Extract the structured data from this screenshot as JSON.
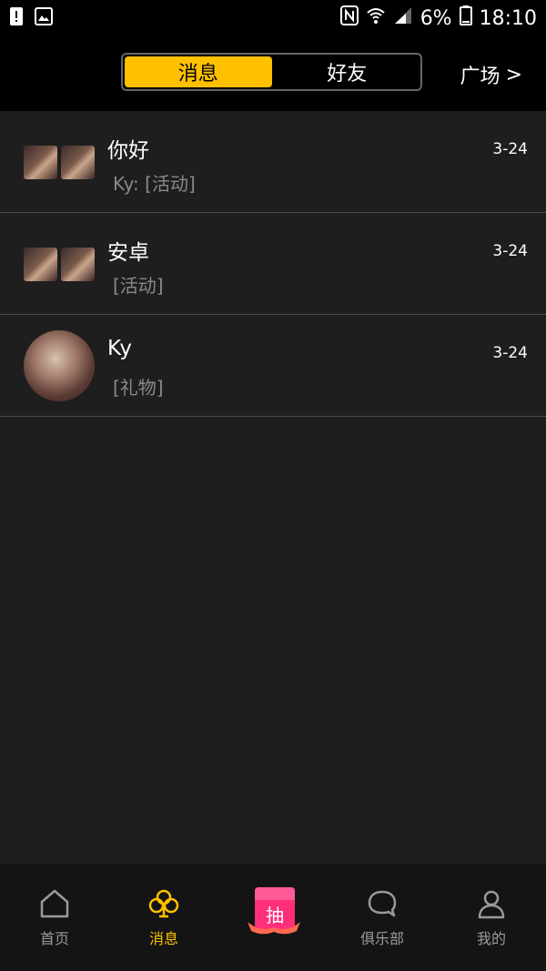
{
  "status_bar": {
    "battery_percent": "6%",
    "time": "18:10",
    "icons": [
      "alert-icon",
      "image-icon",
      "nfc-icon",
      "wifi-icon",
      "signal-icon",
      "battery-icon"
    ]
  },
  "header": {
    "tabs": [
      {
        "label": "消息",
        "active": true
      },
      {
        "label": "好友",
        "active": false
      }
    ],
    "plaza_label": "广场",
    "plaza_chevron": ">",
    "accent_color": "#ffc000"
  },
  "messages": [
    {
      "title": "你好",
      "subtitle": "Ky: [活动]",
      "date": "3-24",
      "avatar": "group"
    },
    {
      "title": "安卓",
      "subtitle": "[活动]",
      "date": "3-24",
      "avatar": "group"
    },
    {
      "title": "Ky",
      "subtitle": "[礼物]",
      "date": "3-24",
      "avatar": "single"
    }
  ],
  "bottom_nav": {
    "items": [
      {
        "label": "首页",
        "icon": "home-icon",
        "active": false
      },
      {
        "label": "消息",
        "icon": "club-icon",
        "active": true
      },
      {
        "label": "",
        "icon": "lottery-icon",
        "active": false
      },
      {
        "label": "俱乐部",
        "icon": "chat-bubble-icon",
        "active": false
      },
      {
        "label": "我的",
        "icon": "user-icon",
        "active": false
      }
    ],
    "lottery_label": "抽"
  }
}
